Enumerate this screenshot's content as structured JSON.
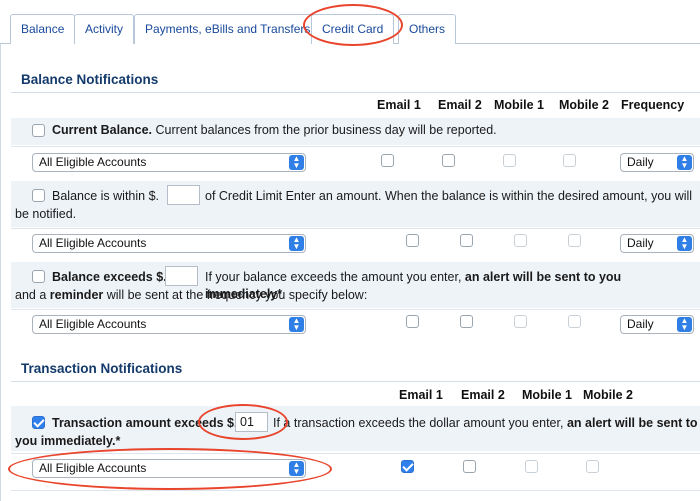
{
  "tabs": [
    {
      "label": "Balance"
    },
    {
      "label": "Activity"
    },
    {
      "label": "Payments, eBills and Transfers"
    },
    {
      "label": "Credit Card"
    },
    {
      "label": "Others"
    }
  ],
  "active_tab": "Credit Card",
  "balance_notifications": {
    "title": "Balance Notifications",
    "columns": [
      "Email 1",
      "Email 2",
      "Mobile 1",
      "Mobile 2",
      "Frequency"
    ],
    "current_balance": {
      "label_bold": "Current Balance.",
      "label_rest": "Current balances from the prior business day will be reported.",
      "account": "All Eligible Accounts",
      "frequency": "Daily"
    },
    "balance_within": {
      "label_bold": "Balance is within $.",
      "label_rest": "of Credit Limit Enter an amount. When the balance is within the desired amount, you will",
      "label_line2": "be notified.",
      "amount": "",
      "account": "All Eligible Accounts",
      "frequency": "Daily"
    },
    "balance_exceeds": {
      "label_bold": "Balance exceeds $.",
      "label_rest_a": "If your balance exceeds the amount you enter,",
      "label_rest_b": "an alert will be sent to you immediately*",
      "line2_a": "and a",
      "line2_b": "reminder",
      "line2_c": "will be sent at the frequency you specify below:",
      "amount": "",
      "account": "All Eligible Accounts",
      "frequency": "Daily"
    }
  },
  "transaction_notifications": {
    "title": "Transaction Notifications",
    "columns": [
      "Email 1",
      "Email 2",
      "Mobile 1",
      "Mobile 2"
    ],
    "amount_exceeds": {
      "label_bold": "Transaction amount exceeds $.",
      "amount": "01",
      "label_rest": "If a transaction exceeds the dollar amount you enter,",
      "label_bold2": "an alert will be sent to",
      "label_line2": "you immediately.*",
      "account": "All Eligible Accounts"
    }
  },
  "annotation_color": "#e8452c",
  "accent_color": "#2f80ed"
}
